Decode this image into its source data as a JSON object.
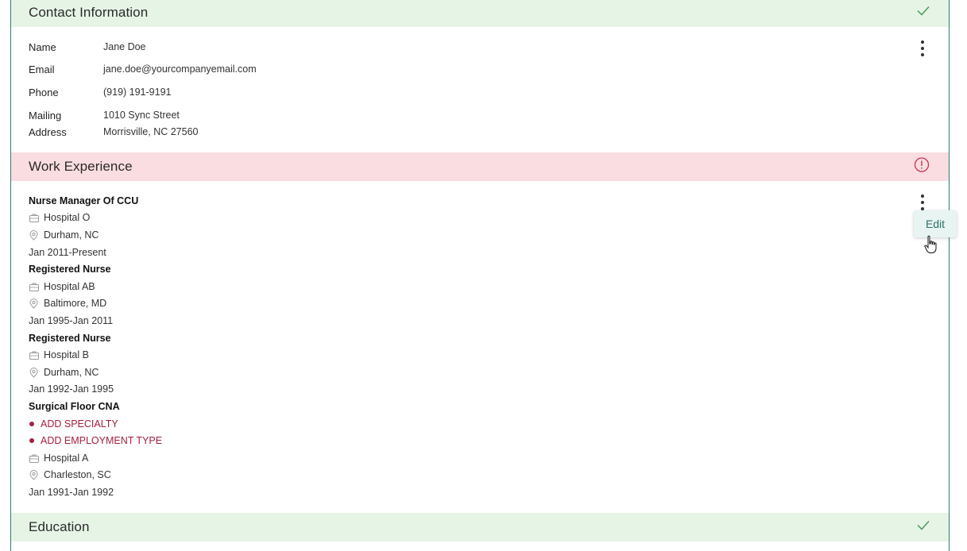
{
  "contact": {
    "title": "Contact Information",
    "fields": {
      "name_label": "Name",
      "name_value": "Jane Doe",
      "email_label": "Email",
      "email_value": "jane.doe@yourcompanyemail.com",
      "phone_label": "Phone",
      "phone_value": "(919) 191-9191",
      "address_label_1": "Mailing",
      "address_label_2": "Address",
      "address_line_1": "1010 Sync Street",
      "address_line_2": "Morrisville, NC 27560"
    }
  },
  "work": {
    "title": "Work Experience",
    "jobs": [
      {
        "title": "Nurse Manager Of CCU",
        "employer": "Hospital O",
        "location": "Durham, NC",
        "dates": "Jan 2011-Present"
      },
      {
        "title": "Registered Nurse",
        "employer": "Hospital AB",
        "location": "Baltimore, MD",
        "dates": "Jan 1995-Jan 2011"
      },
      {
        "title": "Registered Nurse",
        "employer": "Hospital B",
        "location": "Durham, NC",
        "dates": "Jan 1992-Jan 1995"
      },
      {
        "title": "Surgical Floor CNA",
        "add_specialty": "ADD SPECIALTY",
        "add_employment_type": "ADD EMPLOYMENT TYPE",
        "employer": "Hospital A",
        "location": "Charleston, SC",
        "dates": "Jan 1991-Jan 1992"
      }
    ],
    "menu": {
      "edit_label": "Edit"
    }
  },
  "education": {
    "title": "Education"
  },
  "colors": {
    "ok_header": "#e6f4e6",
    "warn_header": "#f9dde0",
    "accent": "#2e7d74",
    "warning": "#c8344c"
  }
}
